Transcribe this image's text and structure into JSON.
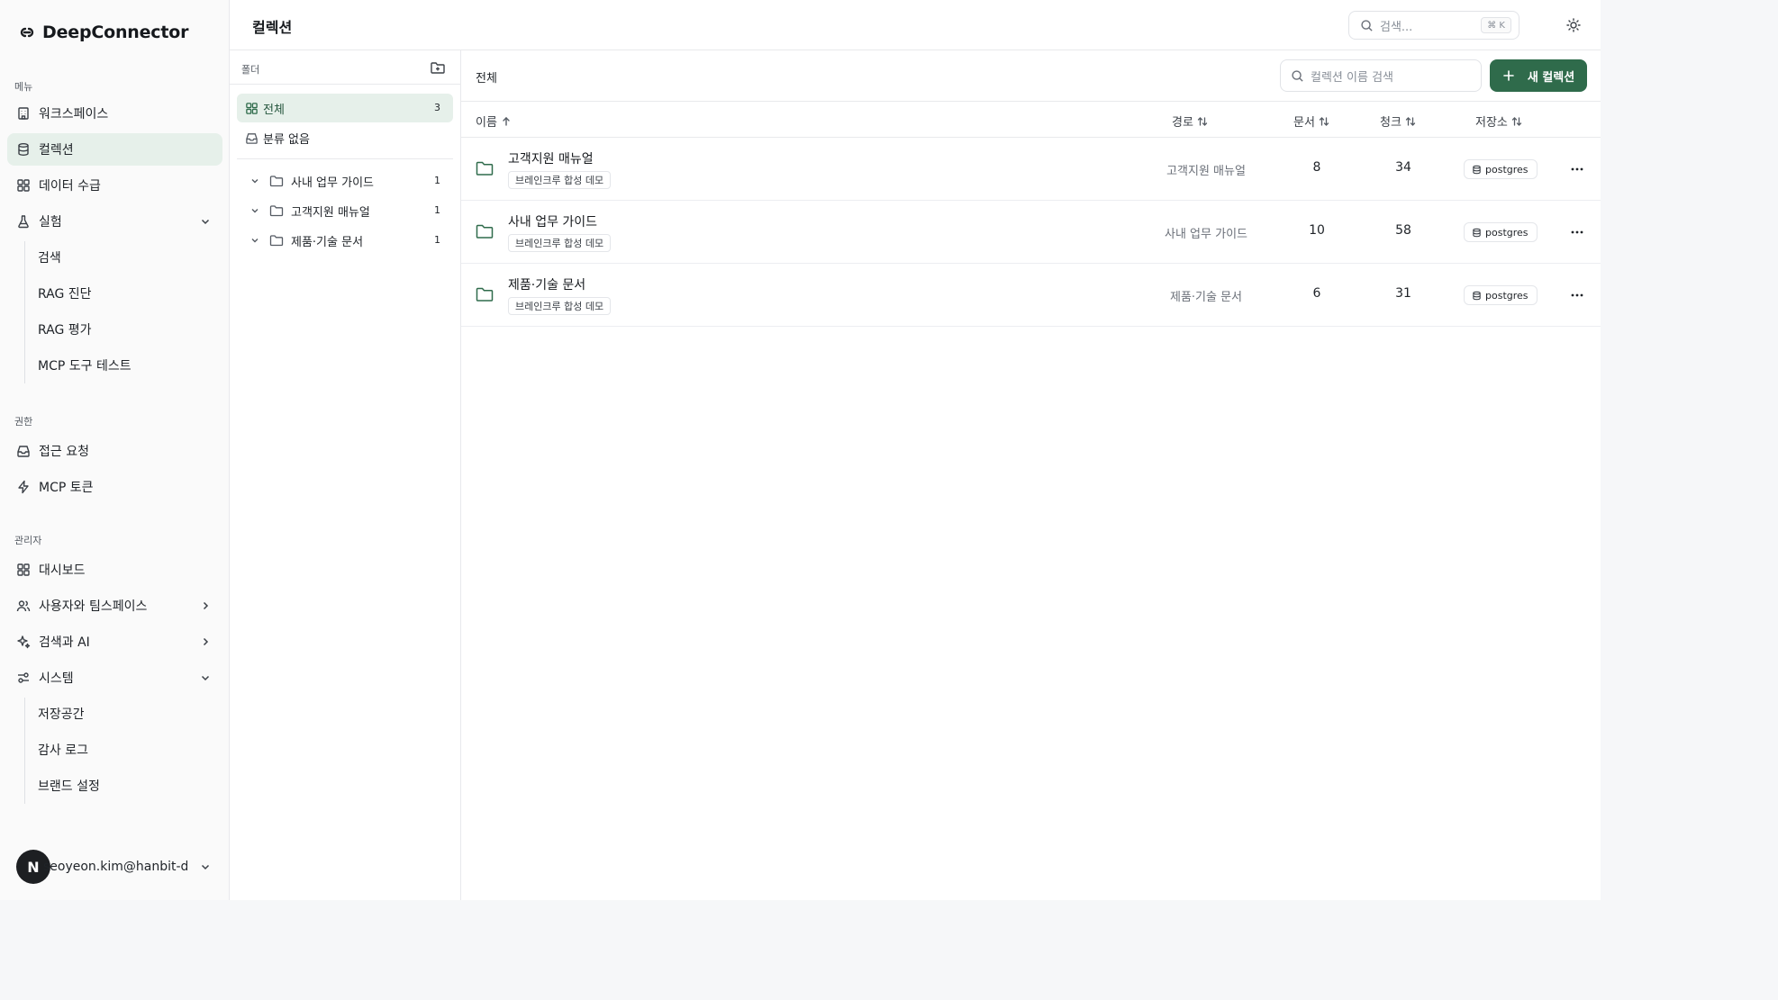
{
  "brand": {
    "name": "DeepConnector"
  },
  "sidebar": {
    "menu_label": "메뉴",
    "menu_items": [
      {
        "label": "워크스페이스",
        "icon": "building-icon"
      },
      {
        "label": "컬렉션",
        "icon": "database-icon",
        "active": true
      },
      {
        "label": "데이터 수급",
        "icon": "grid-icon"
      },
      {
        "label": "실험",
        "icon": "flask-icon",
        "expanded": true
      }
    ],
    "experiment_sub": [
      {
        "label": "검색"
      },
      {
        "label": "RAG 진단"
      },
      {
        "label": "RAG 평가"
      },
      {
        "label": "MCP 도구 테스트"
      }
    ],
    "perm_label": "권한",
    "perm_items": [
      {
        "label": "접근 요청",
        "icon": "inbox-icon"
      },
      {
        "label": "MCP 토큰",
        "icon": "bolt-icon"
      }
    ],
    "admin_label": "관리자",
    "admin_items": [
      {
        "label": "대시보드",
        "icon": "grid-icon"
      },
      {
        "label": "사용자와 팀스페이스",
        "icon": "users-icon"
      },
      {
        "label": "검색과 AI",
        "icon": "sparkle-icon"
      },
      {
        "label": "시스템",
        "icon": "sliders-icon",
        "expanded": true
      }
    ],
    "system_sub": [
      {
        "label": "저장공간"
      },
      {
        "label": "감사 로그"
      },
      {
        "label": "브랜드 설정"
      }
    ],
    "user": {
      "avatar": "N",
      "email": "seoyeon.kim@hanbit-de..."
    }
  },
  "header": {
    "title": "컬렉션",
    "search_placeholder": "검색...",
    "shortcut": "⌘ K"
  },
  "folders": {
    "label": "폴더",
    "all": {
      "label": "전체",
      "count": "3"
    },
    "uncategorized": {
      "label": "분류 없음"
    },
    "tree": [
      {
        "label": "사내 업무 가이드",
        "count": "1"
      },
      {
        "label": "고객지원 매뉴얼",
        "count": "1"
      },
      {
        "label": "제품·기술 문서",
        "count": "1"
      }
    ]
  },
  "main": {
    "breadcrumb": "전체",
    "search_placeholder": "컬렉션 이름 검색",
    "new_button": "새 컬렉션",
    "columns": {
      "name": "이름",
      "path": "경로",
      "docs": "문서",
      "chunks": "청크",
      "storage": "저장소"
    },
    "rows": [
      {
        "name": "고객지원 매뉴얼",
        "tag": "브레인크루 합성 데모",
        "path": "고객지원 매뉴얼",
        "docs": "8",
        "chunks": "34",
        "storage": "postgres"
      },
      {
        "name": "사내 업무 가이드",
        "tag": "브레인크루 합성 데모",
        "path": "사내 업무 가이드",
        "docs": "10",
        "chunks": "58",
        "storage": "postgres"
      },
      {
        "name": "제품·기술 문서",
        "tag": "브레인크루 합성 데모",
        "path": "제품·기술 문서",
        "docs": "6",
        "chunks": "31",
        "storage": "postgres"
      }
    ]
  },
  "colors": {
    "accent": "#2f6b4b",
    "active_bg": "#e6f0ea"
  }
}
